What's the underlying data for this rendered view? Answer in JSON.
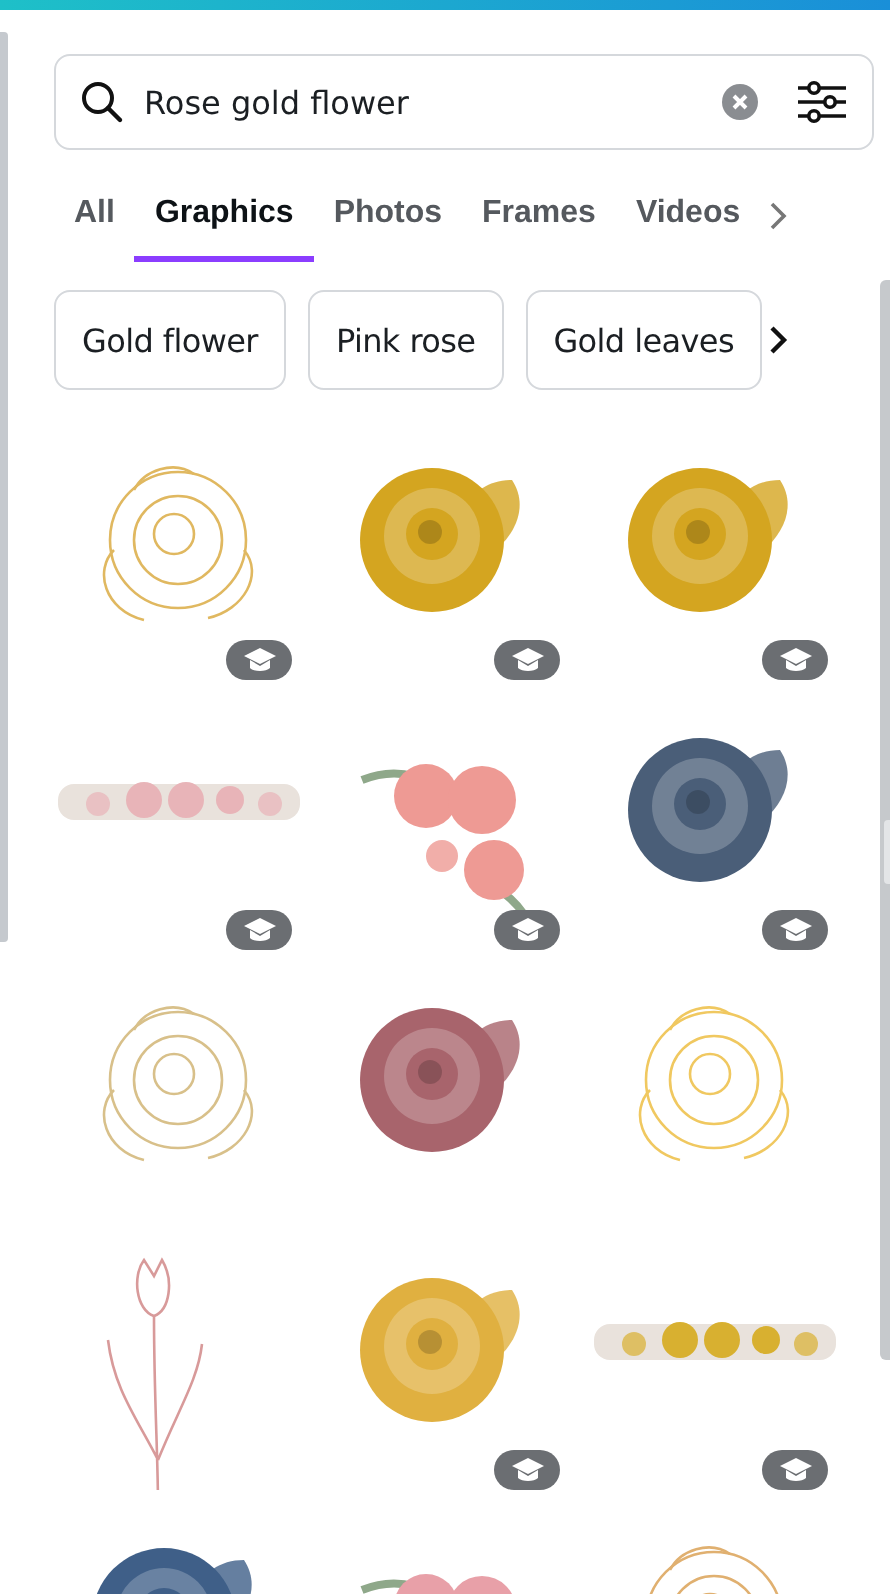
{
  "search": {
    "value": "Rose gold flower"
  },
  "tabs": [
    {
      "label": "All",
      "selected": false
    },
    {
      "label": "Graphics",
      "selected": true
    },
    {
      "label": "Photos",
      "selected": false
    },
    {
      "label": "Frames",
      "selected": false
    },
    {
      "label": "Videos",
      "selected": false
    }
  ],
  "suggestions": [
    "Gold flower",
    "Pink rose",
    "Gold leaves"
  ],
  "results": [
    {
      "kind": "line",
      "color": "#e0b860",
      "premium": true
    },
    {
      "kind": "solid",
      "color": "#d4a520",
      "premium": true
    },
    {
      "kind": "solid",
      "color": "#d4a520",
      "premium": true
    },
    {
      "kind": "border",
      "color": "#e8b4b8",
      "premium": true
    },
    {
      "kind": "bouquet",
      "color": "#ee9a94",
      "premium": true
    },
    {
      "kind": "solid",
      "color": "#4a5e78",
      "premium": true
    },
    {
      "kind": "line",
      "color": "#d8c08a",
      "premium": false
    },
    {
      "kind": "solid",
      "color": "#a8646c",
      "premium": false
    },
    {
      "kind": "line",
      "color": "#f0c860",
      "premium": false
    },
    {
      "kind": "tulip",
      "color": "#d89a9a",
      "premium": false
    },
    {
      "kind": "solid",
      "color": "#e0b040",
      "premium": true
    },
    {
      "kind": "border",
      "color": "#d8b030",
      "premium": true
    },
    {
      "kind": "solid",
      "color": "#3f5f88"
    },
    {
      "kind": "bouquet",
      "color": "#e8a0a8"
    },
    {
      "kind": "line",
      "color": "#e0b070"
    }
  ]
}
